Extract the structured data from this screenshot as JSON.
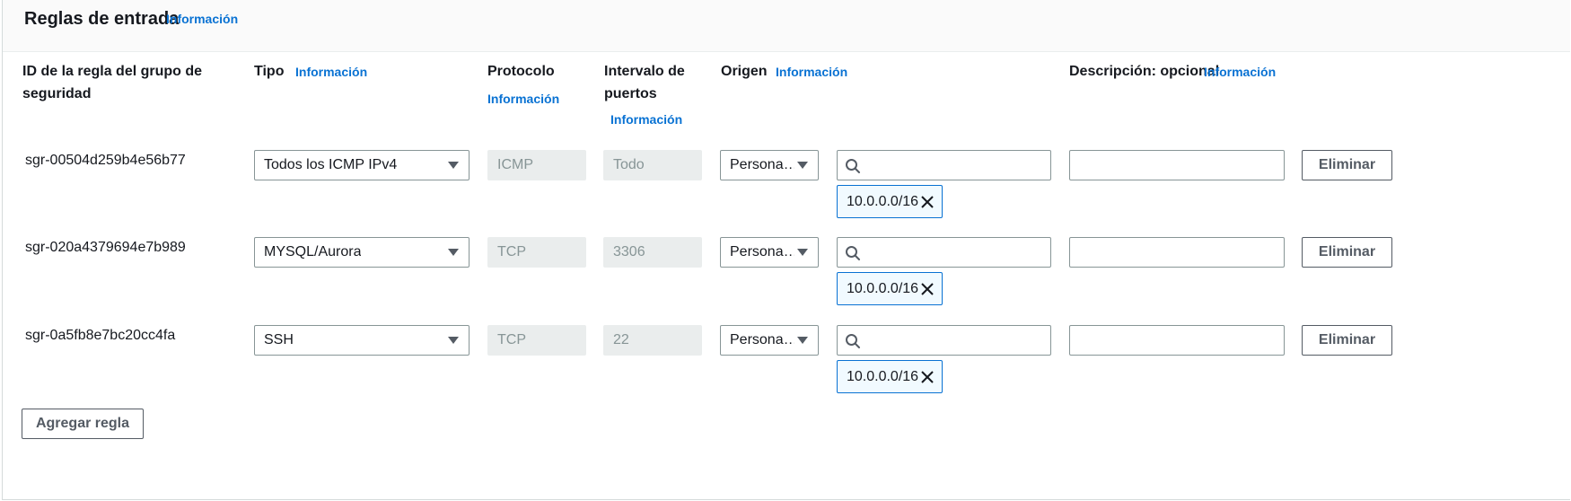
{
  "panel": {
    "title": "Reglas de entrada",
    "title_info": "Información"
  },
  "columns": {
    "id": "ID de la regla del grupo de seguridad",
    "id_line1": "ID de la regla del grupo de",
    "id_line2": "seguridad",
    "type": "Tipo",
    "type_info": "Información",
    "protocol": "Protocolo",
    "protocol_info": "Información",
    "port_range_line1": "Intervalo de",
    "port_range_line2": "puertos",
    "port_range_info": "Información",
    "source": "Origen",
    "source_info": "Información",
    "description": "Descripción: opcional",
    "description_info": "Información"
  },
  "rules": [
    {
      "id": "sgr-00504d259b4e56b77",
      "type": "Todos los ICMP IPv4",
      "protocol": "ICMP",
      "port_range": "Todo",
      "source_type": "Persona…",
      "source_search_value": "",
      "source_tokens": [
        "10.0.0.0/16"
      ],
      "description": "",
      "delete_label": "Eliminar"
    },
    {
      "id": "sgr-020a4379694e7b989",
      "type": "MYSQL/Aurora",
      "protocol": "TCP",
      "port_range": "3306",
      "source_type": "Persona…",
      "source_search_value": "",
      "source_tokens": [
        "10.0.0.0/16"
      ],
      "description": "",
      "delete_label": "Eliminar"
    },
    {
      "id": "sgr-0a5fb8e7bc20cc4fa",
      "type": "SSH",
      "protocol": "TCP",
      "port_range": "22",
      "source_type": "Persona…",
      "source_search_value": "",
      "source_tokens": [
        "10.0.0.0/16"
      ],
      "description": "",
      "delete_label": "Eliminar"
    }
  ],
  "add_rule_label": "Agregar regla",
  "icons": {
    "search": "search-icon",
    "caret": "caret-down-icon",
    "remove_token": "close-icon"
  },
  "colors": {
    "link": "#0972d3",
    "token_border": "#0972d3",
    "token_bg": "#f1faff",
    "disabled_bg": "#eaeded",
    "disabled_text": "#879596",
    "button_text": "#545b64"
  }
}
